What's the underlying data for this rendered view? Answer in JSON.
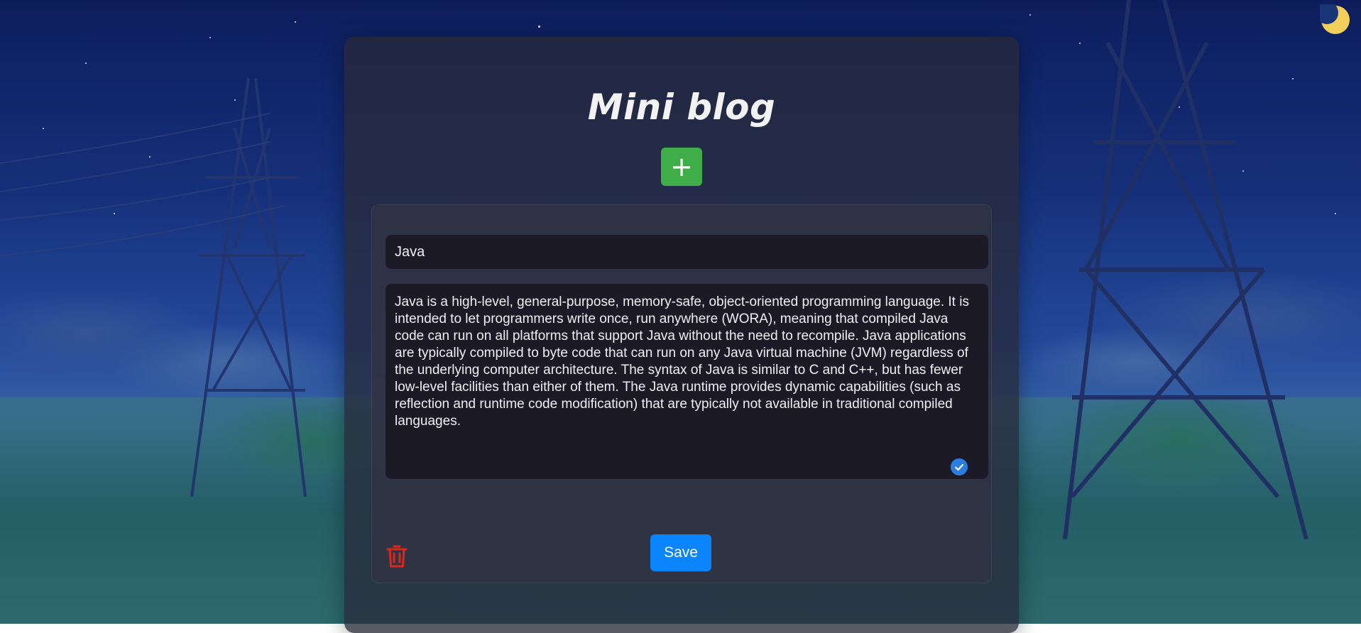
{
  "app": {
    "title": "Mini blog",
    "add_button_label": "+",
    "theme_toggle_icon": "moon-icon"
  },
  "post": {
    "title_value": "Java",
    "body_value": "Java is a high-level, general-purpose, memory-safe, object-oriented programming language. It is intended to let programmers write once, run anywhere (WORA), meaning that compiled Java code can run on all platforms that support Java without the need to recompile. Java applications are typically compiled to byte code that can run on any Java virtual machine (JVM) regardless of the underlying computer architecture. The syntax of Java is similar to C and C++, but has fewer low-level facilities than either of them. The Java runtime provides dynamic capabilities (such as reflection and runtime code modification) that are typically not available in traditional compiled languages.",
    "save_label": "Save",
    "delete_icon": "trash-icon",
    "grammar_icon": "check-circle-icon"
  },
  "colors": {
    "add_button": "#3fae49",
    "save_button": "#0a84ff",
    "delete_icon": "#e0261b",
    "moon": "#f2cf5b",
    "check": "#2a7de1"
  }
}
